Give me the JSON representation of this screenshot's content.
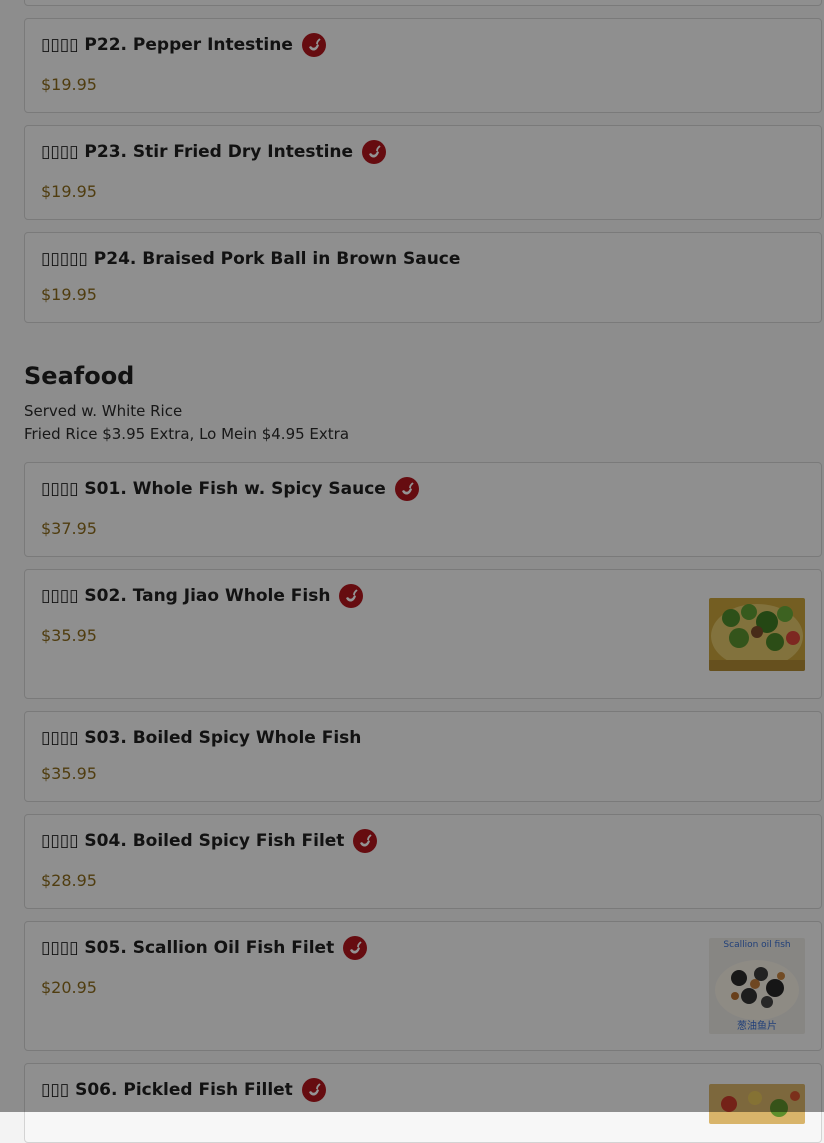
{
  "section": {
    "title": "Seafood",
    "desc1": "Served w. White Rice",
    "desc2": "Fried Rice $3.95 Extra, Lo Mein $4.95 Extra"
  },
  "items": [
    {
      "cn": "▯▯▯▯",
      "name": "P22. Pepper Intestine",
      "price": "$19.95",
      "spicy": true
    },
    {
      "cn": "▯▯▯▯",
      "name": "P23. Stir Fried Dry Intestine",
      "price": "$19.95",
      "spicy": true
    },
    {
      "cn": "▯▯▯▯▯",
      "name": "P24. Braised Pork Ball in Brown Sauce",
      "price": "$19.95",
      "spicy": false
    },
    {
      "cn": "▯▯▯▯",
      "name": "S01. Whole Fish w. Spicy Sauce",
      "price": "$37.95",
      "spicy": true
    },
    {
      "cn": "▯▯▯▯",
      "name": "S02. Tang Jiao Whole Fish",
      "price": "$35.95",
      "spicy": true
    },
    {
      "cn": "▯▯▯▯",
      "name": "S03. Boiled Spicy Whole Fish",
      "price": "$35.95",
      "spicy": false
    },
    {
      "cn": "▯▯▯▯",
      "name": "S04. Boiled Spicy Fish Filet",
      "price": "$28.95",
      "spicy": true
    },
    {
      "cn": "▯▯▯▯",
      "name": "S05. Scallion Oil Fish Filet",
      "price": "$20.95",
      "spicy": true
    },
    {
      "cn": "▯▯▯",
      "name": "S06. Pickled Fish Fillet",
      "price": "",
      "spicy": true
    }
  ],
  "thumb_captions": {
    "s05_top": "Scallion oil fish",
    "s05_bottom": "葱油鱼片"
  },
  "icons": {
    "spicy": "chili-pepper-icon"
  },
  "colors": {
    "spicy_badge": "#b0151d",
    "price": "#8a6a1c",
    "overlay": "rgba(0,0,0,0.42)"
  }
}
